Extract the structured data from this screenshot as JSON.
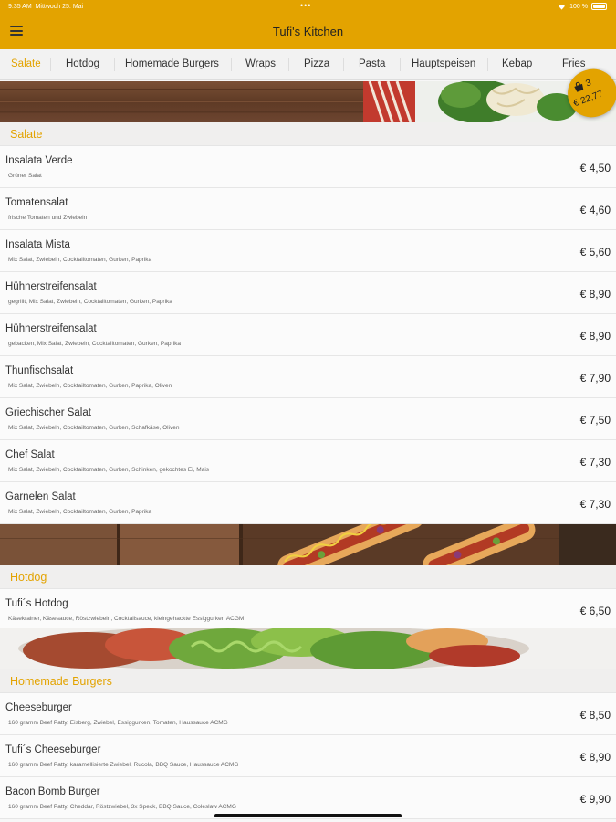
{
  "status_bar": {
    "time": "9:35 AM",
    "date": "Mittwoch 25. Mai",
    "battery": "100 %"
  },
  "header": {
    "title": "Tufi's Kitchen"
  },
  "tabs": [
    {
      "label": "Salate"
    },
    {
      "label": "Hotdog"
    },
    {
      "label": "Homemade Burgers"
    },
    {
      "label": "Wraps"
    },
    {
      "label": "Pizza"
    },
    {
      "label": "Pasta"
    },
    {
      "label": "Hauptspeisen"
    },
    {
      "label": "Kebap"
    },
    {
      "label": "Fries"
    }
  ],
  "cart": {
    "count": "3",
    "total": "€ 22,77"
  },
  "sections": {
    "salate": {
      "title": "Salate",
      "items": [
        {
          "name": "Insalata Verde",
          "desc": "Grüner Salat",
          "price": "€ 4,50"
        },
        {
          "name": "Tomatensalat",
          "desc": "frische Tomaten und Zwiebeln",
          "price": "€ 4,60"
        },
        {
          "name": "Insalata Mista",
          "desc": "Mix Salat, Zwiebeln, Cocktailtomaten, Gurken, Paprika",
          "price": "€ 5,60"
        },
        {
          "name": "Hühnerstreifensalat",
          "desc": "gegrillt, Mix Salat, Zwiebeln, Cocktailtomaten, Gurken, Paprika",
          "price": "€ 8,90"
        },
        {
          "name": "Hühnerstreifensalat",
          "desc": "gebacken, Mix Salat, Zwiebeln, Cocktailtomaten, Gurken, Paprika",
          "price": "€ 8,90"
        },
        {
          "name": "Thunfischsalat",
          "desc": "Mix Salat, Zwiebeln, Cocktailtomaten, Gurken, Paprika, Oliven",
          "price": "€ 7,90"
        },
        {
          "name": "Griechischer Salat",
          "desc": "Mix Salat, Zwiebeln, Cocktailtomaten, Gurken, Schafkäse, Oliven",
          "price": "€ 7,50"
        },
        {
          "name": "Chef Salat",
          "desc": "Mix Salat, Zwiebeln, Cocktailtomaten, Gurken, Schinken, gekochtes Ei, Mais",
          "price": "€ 7,30"
        },
        {
          "name": "Garnelen Salat",
          "desc": "Mix Salat, Zwiebeln, Cocktailtomaten, Gurken, Paprika",
          "price": "€ 7,30"
        }
      ]
    },
    "hotdog": {
      "title": "Hotdog",
      "items": [
        {
          "name": "Tufi´s Hotdog",
          "desc": "Käsekrainer, Käsesauce, Röstzwiebeln, Cocktailsauce, kleingehackte Essiggurken ACGM",
          "price": "€ 6,50"
        }
      ]
    },
    "burgers": {
      "title": "Homemade Burgers",
      "items": [
        {
          "name": "Cheeseburger",
          "desc": "160 gramm Beef Patty, Eisberg, Zwiebel, Essiggurken, Tomaten, Haussauce ACMG",
          "price": "€ 8,50"
        },
        {
          "name": "Tufi´s Cheeseburger",
          "desc": "160 gramm Beef Patty, karamellisierte Zwiebel, Rucola, BBQ Sauce, Haussauce ACMG",
          "price": "€ 8,90"
        },
        {
          "name": "Bacon Bomb Burger",
          "desc": "160 gramm Beef Patty, Cheddar, Röstzwiebel, 3x Speck, BBQ Sauce, Coleslaw ACMG",
          "price": "€ 9,90"
        }
      ]
    }
  },
  "colors": {
    "accent": "#e3a300",
    "background": "#f7f7f7"
  }
}
